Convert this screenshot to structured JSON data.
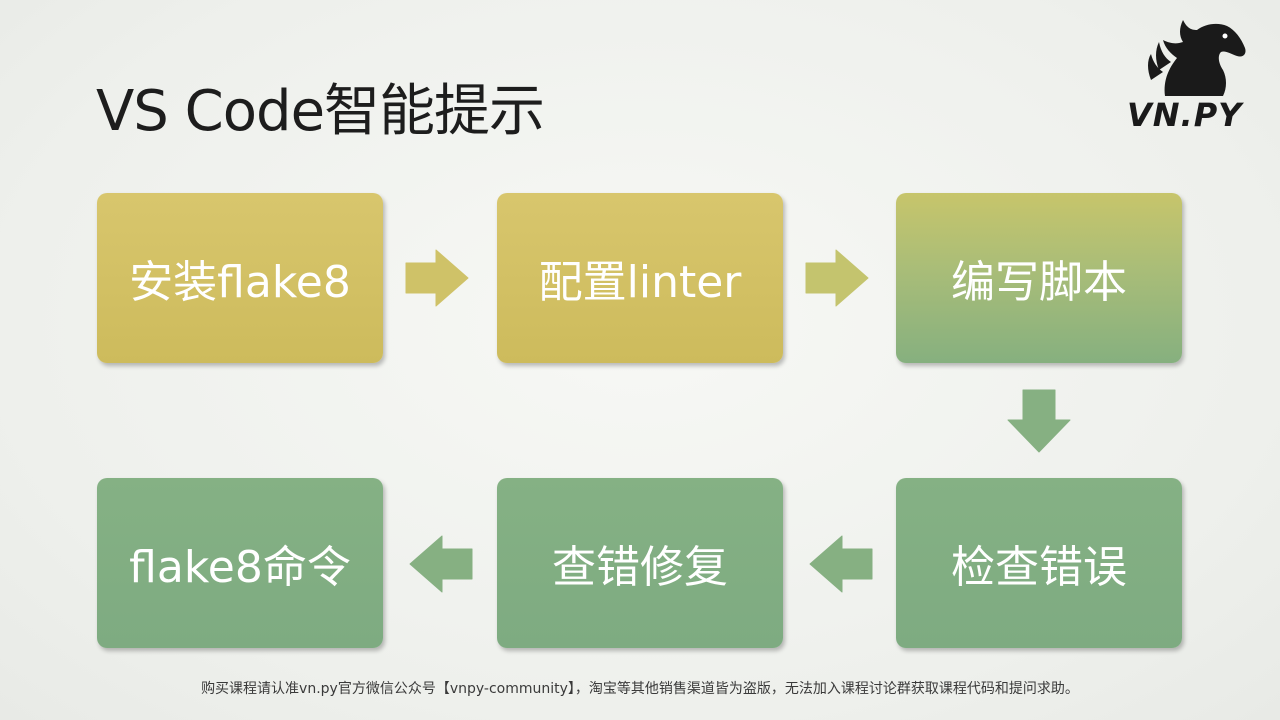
{
  "title": "VS Code智能提示",
  "logo": {
    "text": "VN.PY",
    "icon": "horse-head-icon"
  },
  "steps": [
    {
      "label": "安装flake8"
    },
    {
      "label": "配置linter"
    },
    {
      "label": "编写脚本"
    },
    {
      "label": "检查错误"
    },
    {
      "label": "查错修复"
    },
    {
      "label": "flake8命令"
    }
  ],
  "footer": "购买课程请认准vn.py官方微信公众号【vnpy-community】，淘宝等其他销售渠道皆为盗版，无法加入课程讨论群获取课程代码和提问求助。",
  "colors": {
    "yellow": "#d8c66d",
    "green": "#85b184",
    "arrow_yellow": "#cfc268",
    "arrow_green": "#86b082"
  }
}
